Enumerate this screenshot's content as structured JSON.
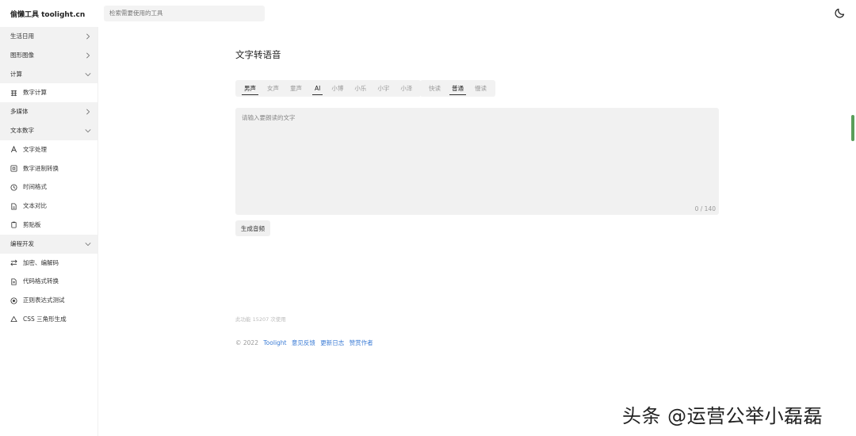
{
  "header": {
    "brand": "偷懒工具 toolight.cn",
    "search_placeholder": "检索需要使用的工具"
  },
  "sidebar": {
    "groups": [
      {
        "label": "生活日用",
        "expanded": false
      },
      {
        "label": "图形图像",
        "expanded": false
      },
      {
        "label": "计算",
        "expanded": true,
        "items": [
          {
            "label": "数字计算",
            "icon": "abacus-icon"
          }
        ]
      },
      {
        "label": "多媒体",
        "expanded": false
      },
      {
        "label": "文本数字",
        "expanded": true,
        "items": [
          {
            "label": "文字处理",
            "icon": "text-a-icon"
          },
          {
            "label": "数字进制转换",
            "icon": "binary-icon"
          },
          {
            "label": "时间格式",
            "icon": "clock-icon"
          },
          {
            "label": "文本对比",
            "icon": "document-compare-icon"
          },
          {
            "label": "剪贴板",
            "icon": "clipboard-icon"
          }
        ]
      },
      {
        "label": "编程开发",
        "expanded": true,
        "items": [
          {
            "label": "加密、编解码",
            "icon": "swap-arrows-icon"
          },
          {
            "label": "代码格式转换",
            "icon": "code-file-icon"
          },
          {
            "label": "正则表达式测试",
            "icon": "regex-icon"
          },
          {
            "label": "CSS 三角形生成",
            "icon": "triangle-icon"
          }
        ]
      }
    ]
  },
  "main": {
    "title": "文字转语音",
    "voice_gender": {
      "options": [
        "男声",
        "女声",
        "童声"
      ],
      "selected": "男声"
    },
    "voice_model": {
      "options": [
        "AI",
        "小博",
        "小乐",
        "小宇",
        "小泽"
      ],
      "selected": "AI"
    },
    "speed": {
      "options": [
        "快读",
        "普通",
        "慢读"
      ],
      "selected": "普通"
    },
    "textarea": {
      "placeholder": "请输入要朗读的文字",
      "counter": "0 / 140"
    },
    "generate_button": "生成音频"
  },
  "footer": {
    "usage_text": "此功能 15207 次使用",
    "copyright": "© 2022",
    "links": [
      "Toolight",
      "意见反馈",
      "更新日志",
      "赞赏作者"
    ]
  },
  "watermark": "头条 @运营公举小磊磊",
  "colors": {
    "link": "#3a7bd5",
    "scroll_thumb": "#5a9e5a",
    "sidebar_group_bg": "#f2f2f2"
  }
}
